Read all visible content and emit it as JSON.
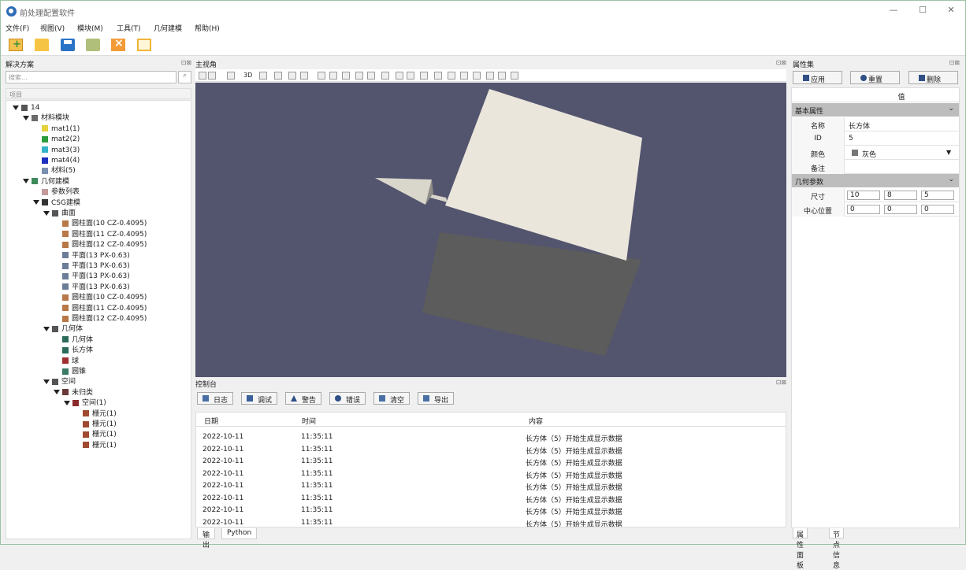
{
  "app": {
    "title": "前处理配置软件",
    "win_min": "—",
    "win_max": "☐",
    "win_close": "✕"
  },
  "menu": [
    "文件(F)",
    "视图(V)",
    "模块(M)",
    "工具(T)",
    "几何建模",
    "帮助(H)"
  ],
  "left": {
    "title": "解决方案",
    "search_placeholder": "搜索...",
    "tree_header": "项目",
    "nodes": [
      {
        "label": "14",
        "level": 0,
        "arrow": true,
        "color": "#555555"
      },
      {
        "label": "材料模块",
        "level": 1,
        "arrow": true,
        "color": "#6b6b6b"
      },
      {
        "label": "mat1(1)",
        "level": 2,
        "arrow": false,
        "color": "#e6d23c"
      },
      {
        "label": "mat2(2)",
        "level": 2,
        "arrow": false,
        "color": "#2e9b3c"
      },
      {
        "label": "mat3(3)",
        "level": 2,
        "arrow": false,
        "color": "#34b4c8"
      },
      {
        "label": "mat4(4)",
        "level": 2,
        "arrow": false,
        "color": "#1d2fc0"
      },
      {
        "label": "材料(5)",
        "level": 2,
        "arrow": false,
        "color": "#7b8fb0"
      },
      {
        "label": "几何建模",
        "level": 1,
        "arrow": true,
        "color": "#3e8a5a"
      },
      {
        "label": "参数列表",
        "level": 2,
        "arrow": false,
        "color": "#c49a9a"
      },
      {
        "label": "CSG建模",
        "level": 2,
        "arrow": true,
        "color": "#333333"
      },
      {
        "label": "曲面",
        "level": 3,
        "arrow": true,
        "color": "#555555"
      },
      {
        "label": "圆柱面(10 CZ-0.4095)",
        "level": 4,
        "arrow": false,
        "color": "#b87848"
      },
      {
        "label": "圆柱面(11 CZ-0.4095)",
        "level": 4,
        "arrow": false,
        "color": "#b87848"
      },
      {
        "label": "圆柱面(12 CZ-0.4095)",
        "level": 4,
        "arrow": false,
        "color": "#b87848"
      },
      {
        "label": "平面(13 PX-0.63)",
        "level": 4,
        "arrow": false,
        "color": "#6c7d98"
      },
      {
        "label": "平面(13 PX-0.63)",
        "level": 4,
        "arrow": false,
        "color": "#6c7d98"
      },
      {
        "label": "平面(13 PX-0.63)",
        "level": 4,
        "arrow": false,
        "color": "#6c7d98"
      },
      {
        "label": "平面(13 PX-0.63)",
        "level": 4,
        "arrow": false,
        "color": "#6c7d98"
      },
      {
        "label": "圆柱面(10 CZ-0.4095)",
        "level": 4,
        "arrow": false,
        "color": "#b87848"
      },
      {
        "label": "圆柱面(11 CZ-0.4095)",
        "level": 4,
        "arrow": false,
        "color": "#b87848"
      },
      {
        "label": "圆柱面(12 CZ-0.4095)",
        "level": 4,
        "arrow": false,
        "color": "#b87848"
      },
      {
        "label": "几何体",
        "level": 3,
        "arrow": true,
        "color": "#555555"
      },
      {
        "label": "几何体",
        "level": 4,
        "arrow": false,
        "color": "#2c6a5a"
      },
      {
        "label": "长方体",
        "level": 4,
        "arrow": false,
        "color": "#2c6a5a"
      },
      {
        "label": "球",
        "level": 4,
        "arrow": false,
        "color": "#a03030"
      },
      {
        "label": "圆锥",
        "level": 4,
        "arrow": false,
        "color": "#3a7a66"
      },
      {
        "label": "空间",
        "level": 3,
        "arrow": true,
        "color": "#555555"
      },
      {
        "label": "未归类",
        "level": 4,
        "arrow": true,
        "color": "#6a3a3a"
      },
      {
        "label": "空间(1)",
        "level": 5,
        "arrow": true,
        "color": "#8a2b2b"
      },
      {
        "label": "栅元(1)",
        "level": 6,
        "arrow": false,
        "color": "#a04a30"
      },
      {
        "label": "栅元(1)",
        "level": 6,
        "arrow": false,
        "color": "#a04a30"
      },
      {
        "label": "栅元(1)",
        "level": 6,
        "arrow": false,
        "color": "#a04a30"
      },
      {
        "label": "栅元(1)",
        "level": 6,
        "arrow": false,
        "color": "#a04a30"
      }
    ]
  },
  "view": {
    "title": "主视角",
    "text_tool": "3D",
    "bg_color": "#53546d"
  },
  "console": {
    "title": "控制台",
    "buttons": [
      {
        "label": "日志",
        "icon": "log-icon"
      },
      {
        "label": "调试",
        "icon": "debug-icon"
      },
      {
        "label": "警告",
        "icon": "warning-icon"
      },
      {
        "label": "错误",
        "icon": "error-icon"
      },
      {
        "label": "清空",
        "icon": "clear-icon"
      },
      {
        "label": "导出",
        "icon": "export-icon"
      }
    ],
    "headers": {
      "date": "日期",
      "time": "时间",
      "content": "内容"
    },
    "rows": [
      {
        "date": "2022-10-11",
        "time": "11:35:11",
        "content": "长方体（5）开始生成显示数据"
      },
      {
        "date": "2022-10-11",
        "time": "11:35:11",
        "content": "长方体（5）开始生成显示数据"
      },
      {
        "date": "2022-10-11",
        "time": "11:35:11",
        "content": "长方体（5）开始生成显示数据"
      },
      {
        "date": "2022-10-11",
        "time": "11:35:11",
        "content": "长方体（5）开始生成显示数据"
      },
      {
        "date": "2022-10-11",
        "time": "11:35:11",
        "content": "长方体（5）开始生成显示数据"
      },
      {
        "date": "2022-10-11",
        "time": "11:35:11",
        "content": "长方体（5）开始生成显示数据"
      },
      {
        "date": "2022-10-11",
        "time": "11:35:11",
        "content": "长方体（5）开始生成显示数据"
      },
      {
        "date": "2022-10-11",
        "time": "11:35:11",
        "content": "长方体（5）开始生成显示数据"
      }
    ],
    "tabs": [
      "输出",
      "Python"
    ]
  },
  "props": {
    "title": "属性集",
    "apply": "应用",
    "reset": "重置",
    "delete": "删除",
    "value_header": "值",
    "basic_section": "基本属性",
    "name_label": "名称",
    "name_value": "长方体",
    "id_label": "ID",
    "id_value": "5",
    "color_label": "颜色",
    "color_value": "灰色",
    "note_label": "备注",
    "geo_section": "几何参数",
    "size_label": "尺寸",
    "size": [
      "10",
      "8",
      "5"
    ],
    "center_label": "中心位置",
    "center": [
      "0",
      "0",
      "0"
    ],
    "tabs": [
      "属性面板",
      "节点信息"
    ]
  }
}
